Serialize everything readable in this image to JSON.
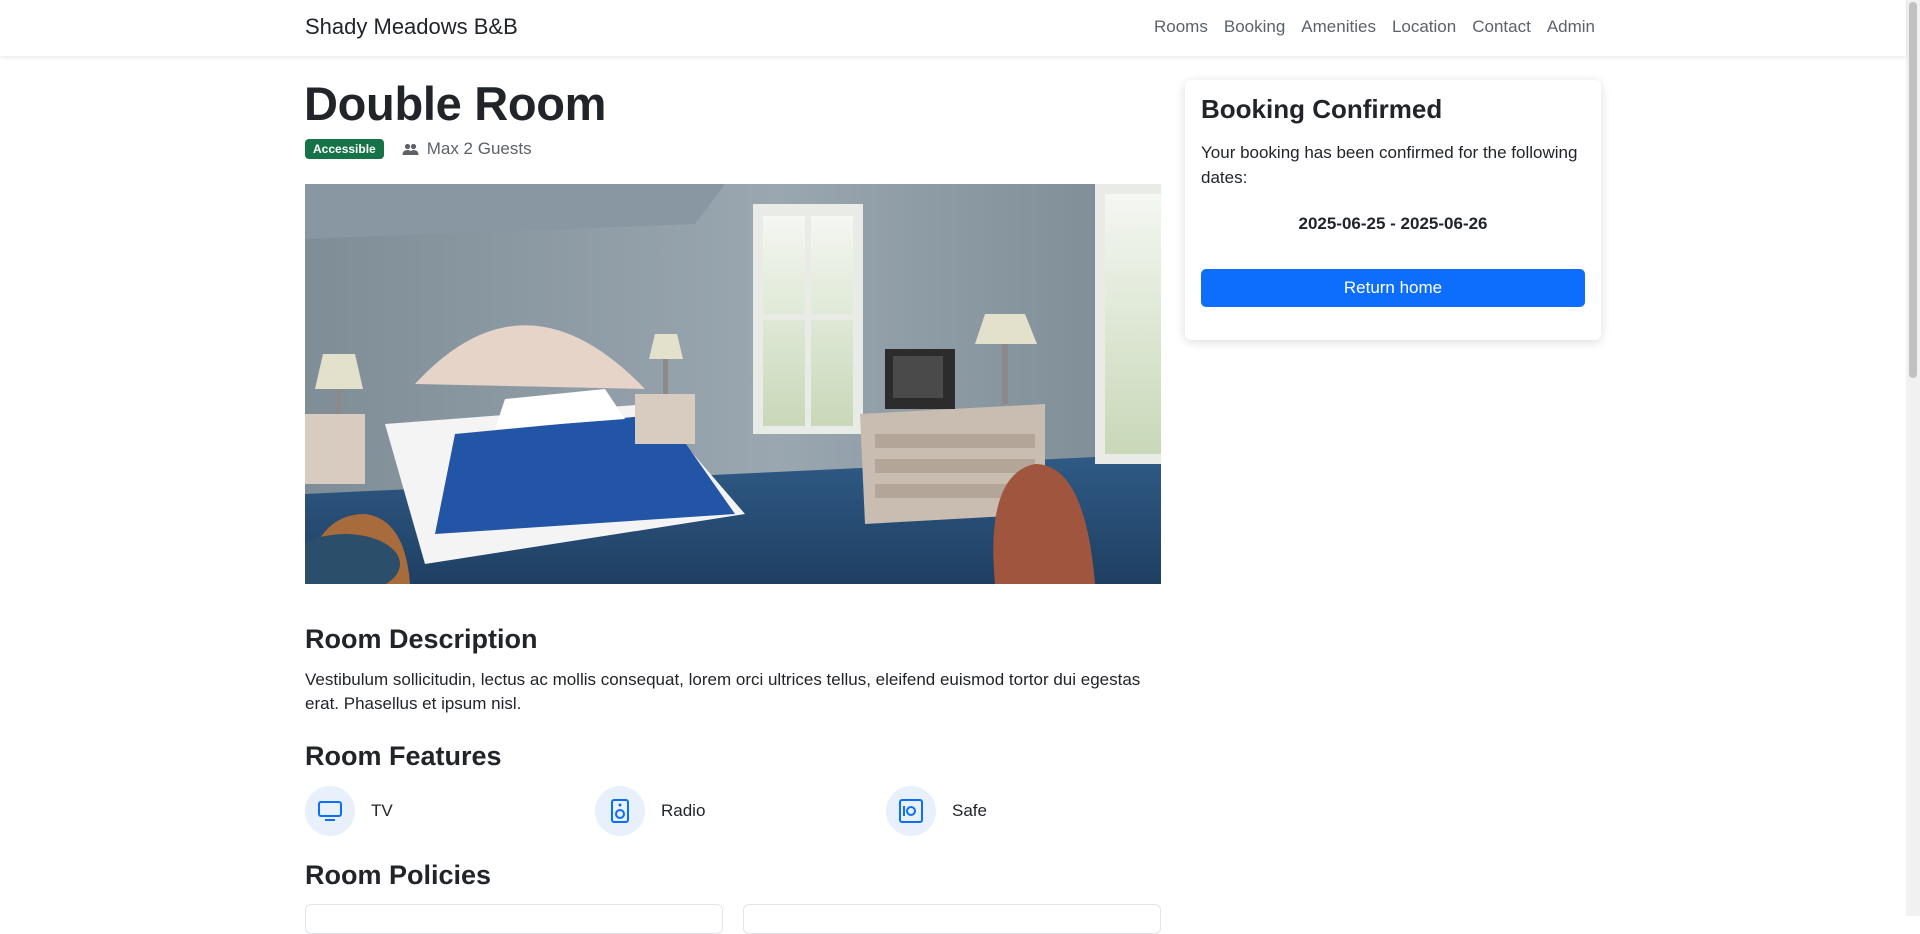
{
  "navbar": {
    "brand": "Shady Meadows B&B",
    "links": [
      "Rooms",
      "Booking",
      "Amenities",
      "Location",
      "Contact",
      "Admin"
    ]
  },
  "room": {
    "title": "Double Room",
    "badge": "Accessible",
    "guests": "Max 2 Guests",
    "image_icon": "room-photo"
  },
  "description": {
    "heading": "Room Description",
    "text": "Vestibulum sollicitudin, lectus ac mollis consequat, lorem orci ultrices tellus, eleifend euismod tortor dui egestas erat. Phasellus et ipsum nisl."
  },
  "features": {
    "heading": "Room Features",
    "items": [
      {
        "label": "TV",
        "icon": "tv-icon"
      },
      {
        "label": "Radio",
        "icon": "radio-icon"
      },
      {
        "label": "Safe",
        "icon": "safe-icon"
      }
    ]
  },
  "policies": {
    "heading": "Room Policies"
  },
  "confirmation": {
    "title": "Booking Confirmed",
    "message": "Your booking has been confirmed for the following dates:",
    "dates": "2025-06-25 - 2025-06-26",
    "button": "Return home"
  },
  "colors": {
    "primary": "#0d6efd",
    "badge": "#157347",
    "feature_bg": "#e7f0fb"
  }
}
